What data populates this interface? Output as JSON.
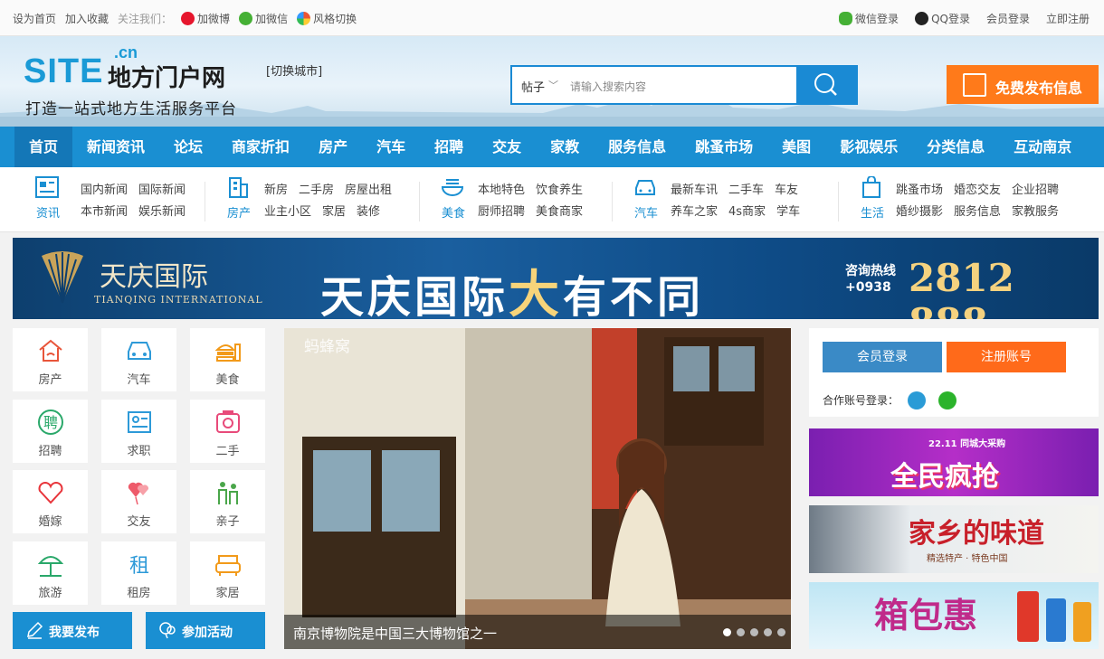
{
  "topbar": {
    "set_home": "设为首页",
    "add_favorite": "加入收藏",
    "follow_us": "关注我们：",
    "add_weibo": "加微博",
    "add_wechat": "加微信",
    "style_switch": "风格切换",
    "wechat_login": "微信登录",
    "qq_login": "QQ登录",
    "member_login": "会员登录",
    "register_now": "立即注册"
  },
  "header": {
    "logo_site": "SITE",
    "logo_cn": ".cn",
    "logo_name": "地方门户网",
    "switch_city": "[切换城市]",
    "slogan": "打造一站式地方生活服务平台",
    "search_category": "帖子",
    "search_placeholder": "请输入搜索内容",
    "publish_button": "免费发布信息"
  },
  "nav": {
    "items": [
      "首页",
      "新闻资讯",
      "论坛",
      "商家折扣",
      "房产",
      "汽车",
      "招聘",
      "交友",
      "家教",
      "服务信息",
      "跳蚤市场",
      "美图",
      "影视娱乐",
      "分类信息",
      "互动南京"
    ]
  },
  "subnav": {
    "groups": [
      {
        "label": "资讯",
        "icon": "news-icon",
        "row1": [
          "国内新闻",
          "国际新闻"
        ],
        "row2": [
          "本市新闻",
          "娱乐新闻"
        ]
      },
      {
        "label": "房产",
        "icon": "building-icon",
        "row1": [
          "新房",
          "二手房",
          "房屋出租"
        ],
        "row2": [
          "业主小区",
          "家居",
          "装修"
        ]
      },
      {
        "label": "美食",
        "icon": "food-bowl-icon",
        "row1": [
          "本地特色",
          "饮食养生"
        ],
        "row2": [
          "厨师招聘",
          "美食商家"
        ]
      },
      {
        "label": "汽车",
        "icon": "car-icon",
        "row1": [
          "最新车讯",
          "二手车",
          "车友"
        ],
        "row2": [
          "养车之家",
          "4s商家",
          "学车"
        ]
      },
      {
        "label": "生活",
        "icon": "shopping-bag-icon",
        "row1": [
          "跳蚤市场",
          "婚恋交友",
          "企业招聘"
        ],
        "row2": [
          "婚纱摄影",
          "服务信息",
          "家教服务"
        ]
      }
    ]
  },
  "banner": {
    "brand_cn": "天庆国际",
    "brand_en": "TIANQING INTERNATIONAL",
    "headline_pre": "天庆国际",
    "headline_big": "大",
    "headline_post": "有不同",
    "hotline_label": "咨询热线",
    "hotline_prefix": "+0938",
    "hotline_number": "2812 888"
  },
  "categories": [
    {
      "label": "房产",
      "icon": "house-icon",
      "color": "#e8553a"
    },
    {
      "label": "汽车",
      "icon": "car-icon",
      "color": "#2d9ad8"
    },
    {
      "label": "美食",
      "icon": "burger-icon",
      "color": "#f29a1a"
    },
    {
      "label": "招聘",
      "icon": "hire-icon",
      "color": "#2aa86a"
    },
    {
      "label": "求职",
      "icon": "id-card-icon",
      "color": "#2d9ad8"
    },
    {
      "label": "二手",
      "icon": "camera-icon",
      "color": "#e84a7a"
    },
    {
      "label": "婚嫁",
      "icon": "heart-icon",
      "color": "#e8343a"
    },
    {
      "label": "交友",
      "icon": "balloons-icon",
      "color": "#ee5a6a"
    },
    {
      "label": "亲子",
      "icon": "family-icon",
      "color": "#4aa64a"
    },
    {
      "label": "旅游",
      "icon": "beach-umbrella-icon",
      "color": "#2aa86a"
    },
    {
      "label": "租房",
      "icon": "rent-icon",
      "color": "#2d9ad8"
    },
    {
      "label": "家居",
      "icon": "sofa-icon",
      "color": "#f29a1a"
    }
  ],
  "actions": {
    "publish": "我要发布",
    "join_activity": "参加活动"
  },
  "slider": {
    "watermark": "蚂蜂窝",
    "caption": "南京博物院是中国三大博物馆之一",
    "dots": 5,
    "active_dot": 1
  },
  "login": {
    "member_login": "会员登录",
    "register": "注册账号",
    "partner_login": "合作账号登录："
  },
  "ads": {
    "ad1_text": "全民疯抢",
    "ad1_small": "22.11 同城大采购",
    "ad2_text": "家乡的味道",
    "ad2_small": "精选特产 · 特色中国",
    "ad3_text": "箱包惠"
  },
  "colors": {
    "primary": "#1a8fd2",
    "orange": "#ff7a1a",
    "member_blue": "#3a8ac6",
    "register_orange": "#ff6a1a"
  }
}
